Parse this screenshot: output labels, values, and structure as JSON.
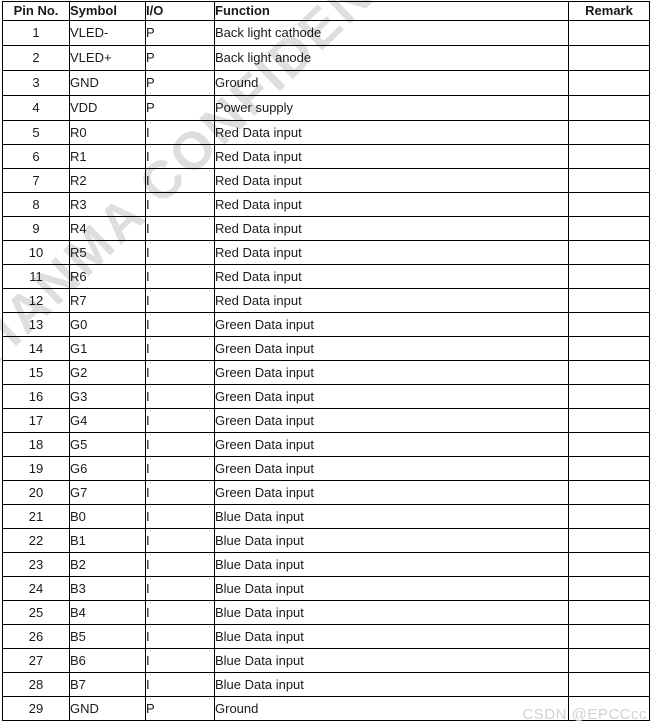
{
  "document": {
    "type": "pin-assignment-table",
    "watermark_diagonal": "TIANMA CONFIDENTIAL",
    "watermark_corner": "CSDN @EPCCcc",
    "colors": {
      "border": "#000000",
      "text": "#1a1a1a",
      "watermark_diagonal": "#dedede",
      "watermark_corner": "#d2d2d2",
      "background": "#ffffff"
    }
  },
  "table": {
    "headers": [
      "Pin No.",
      "Symbol",
      "I/O",
      "Function",
      "Remark"
    ],
    "rows": [
      {
        "pin": "1",
        "symbol": "VLED-",
        "io": "P",
        "function": "Back light cathode",
        "remark": ""
      },
      {
        "pin": "2",
        "symbol": "VLED+",
        "io": "P",
        "function": "Back light anode",
        "remark": ""
      },
      {
        "pin": "3",
        "symbol": "GND",
        "io": "P",
        "function": "Ground",
        "remark": ""
      },
      {
        "pin": "4",
        "symbol": "VDD",
        "io": "P",
        "function": "Power supply",
        "remark": ""
      },
      {
        "pin": "5",
        "symbol": "R0",
        "io": "I",
        "function": "Red Data input",
        "remark": ""
      },
      {
        "pin": "6",
        "symbol": "R1",
        "io": "I",
        "function": "Red Data input",
        "remark": ""
      },
      {
        "pin": "7",
        "symbol": "R2",
        "io": "I",
        "function": "Red Data input",
        "remark": ""
      },
      {
        "pin": "8",
        "symbol": "R3",
        "io": "I",
        "function": "Red Data input",
        "remark": ""
      },
      {
        "pin": "9",
        "symbol": "R4",
        "io": "I",
        "function": "Red Data input",
        "remark": ""
      },
      {
        "pin": "10",
        "symbol": "R5",
        "io": "I",
        "function": "Red Data input",
        "remark": ""
      },
      {
        "pin": "11",
        "symbol": "R6",
        "io": "I",
        "function": "Red Data input",
        "remark": ""
      },
      {
        "pin": "12",
        "symbol": "R7",
        "io": "I",
        "function": "Red Data input",
        "remark": ""
      },
      {
        "pin": "13",
        "symbol": "G0",
        "io": "I",
        "function": "Green Data input",
        "remark": ""
      },
      {
        "pin": "14",
        "symbol": "G1",
        "io": "I",
        "function": "Green Data input",
        "remark": ""
      },
      {
        "pin": "15",
        "symbol": "G2",
        "io": "I",
        "function": "Green Data input",
        "remark": ""
      },
      {
        "pin": "16",
        "symbol": "G3",
        "io": "I",
        "function": "Green Data input",
        "remark": ""
      },
      {
        "pin": "17",
        "symbol": "G4",
        "io": "I",
        "function": "Green Data input",
        "remark": ""
      },
      {
        "pin": "18",
        "symbol": "G5",
        "io": "I",
        "function": "Green Data input",
        "remark": ""
      },
      {
        "pin": "19",
        "symbol": "G6",
        "io": "I",
        "function": "Green Data input",
        "remark": ""
      },
      {
        "pin": "20",
        "symbol": "G7",
        "io": "I",
        "function": "Green Data input",
        "remark": ""
      },
      {
        "pin": "21",
        "symbol": "B0",
        "io": "I",
        "function": "Blue Data input",
        "remark": ""
      },
      {
        "pin": "22",
        "symbol": "B1",
        "io": "I",
        "function": "Blue Data input",
        "remark": ""
      },
      {
        "pin": "23",
        "symbol": "B2",
        "io": "I",
        "function": "Blue Data input",
        "remark": ""
      },
      {
        "pin": "24",
        "symbol": "B3",
        "io": "I",
        "function": "Blue Data input",
        "remark": ""
      },
      {
        "pin": "25",
        "symbol": "B4",
        "io": "I",
        "function": "Blue Data input",
        "remark": ""
      },
      {
        "pin": "26",
        "symbol": "B5",
        "io": "I",
        "function": "Blue Data input",
        "remark": ""
      },
      {
        "pin": "27",
        "symbol": "B6",
        "io": "I",
        "function": "Blue Data input",
        "remark": ""
      },
      {
        "pin": "28",
        "symbol": "B7",
        "io": "I",
        "function": "Blue Data input",
        "remark": ""
      },
      {
        "pin": "29",
        "symbol": "GND",
        "io": "P",
        "function": "Ground",
        "remark": ""
      }
    ]
  }
}
